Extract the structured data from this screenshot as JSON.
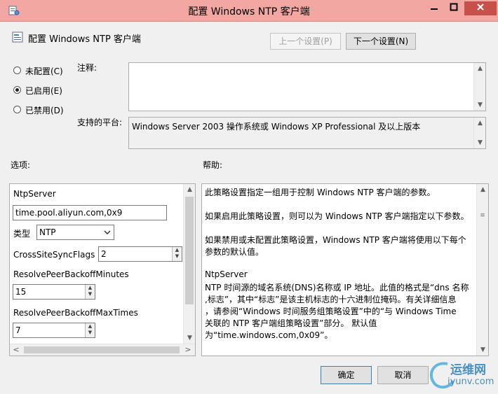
{
  "window": {
    "title": "配置 Windows NTP 客户端"
  },
  "header": {
    "policy_name": "配置 Windows NTP 客户端",
    "prev_label": "上一个设置(P)",
    "next_label": "下一个设置(N)"
  },
  "state": {
    "options": [
      {
        "label": "未配置(C)",
        "selected": false
      },
      {
        "label": "已启用(E)",
        "selected": true
      },
      {
        "label": "已禁用(D)",
        "selected": false
      }
    ]
  },
  "comment": {
    "label": "注释:",
    "value": ""
  },
  "platform": {
    "label": "支持的平台:",
    "value": "Windows Server 2003 操作系统或 Windows XP Professional 及以上版本"
  },
  "options_panel": {
    "label": "选项:",
    "ntpserver_label": "NtpServer",
    "ntpserver_value": "time.pool.aliyun.com,0x9",
    "type_label": "类型",
    "type_value": "NTP",
    "crosssite_label": "CrossSiteSyncFlags",
    "crosssite_value": "2",
    "backoff_min_label": "ResolvePeerBackoffMinutes",
    "backoff_min_value": "15",
    "backoff_max_label": "ResolvePeerBackoffMaxTimes",
    "backoff_max_value": "7"
  },
  "help_panel": {
    "label": "帮助:",
    "lines": [
      "此策略设置指定一组用于控制 Windows NTP 客户端的参数。",
      "",
      "如果启用此策略设置，则可以为 Windows NTP 客户端指定以下参数。",
      "",
      "如果禁用或未配置此策略设置，Windows NTP 客户端将使用以下每个",
      "参数的默认值。",
      "",
      "NtpServer",
      "NTP 时间源的域名系统(DNS)名称或 IP 地址。此值的格式是“dns 名称",
      ",标志”，其中“标志”是该主机标志的十六进制位掩码。有关详细信息",
      "，请参阅“Windows 时间服务组策略设置”中的“与 Windows Time",
      "关联的 NTP 客户端组策略设置”部分。 默认值",
      "为“time.windows.com,0x09”。"
    ]
  },
  "footer": {
    "ok_label": "确定",
    "cancel_label": "取消"
  },
  "watermark": {
    "text": "运维网",
    "sub": "iyunv.com"
  },
  "colors": {
    "titlebar": "#f3a7a2",
    "close": "#c7504a",
    "accent": "#3c7fb1"
  }
}
